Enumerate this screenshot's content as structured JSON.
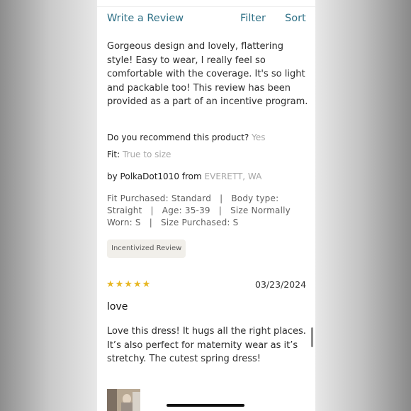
{
  "toolbar": {
    "write_review": "Write a Review",
    "filter": "Filter",
    "sort": "Sort"
  },
  "review1": {
    "body": "Gorgeous design and lovely, flattering style! Easy to wear, I really feel so comfortable with the coverage.  It's so light and packable too! This review has been provided as a part of an incentive program.",
    "recommend_label": "Do you recommend this product?",
    "recommend_value": "Yes",
    "fit_label": "Fit:",
    "fit_value": "True to size",
    "by_prefix": "by",
    "author": "PolkaDot1010",
    "from_word": "from",
    "location": "EVERETT, WA",
    "details": "Fit Purchased: Standard   |   Body type: Straight   |   Age: 35-39   |   Size Normally Worn: S   |   Size Purchased: S",
    "badge": "Incentivized Review"
  },
  "review2": {
    "stars": "★★★★★",
    "rating": 5,
    "date": "03/23/2024",
    "title": "love",
    "body": "Love this dress! It hugs all the right places. It’s also perfect for maternity wear as it’s stretchy. The cutest spring dress!"
  },
  "colors": {
    "link": "#2e7086",
    "star": "#e7b621",
    "muted": "#a6a6a6",
    "badge_bg": "#f1efea"
  }
}
